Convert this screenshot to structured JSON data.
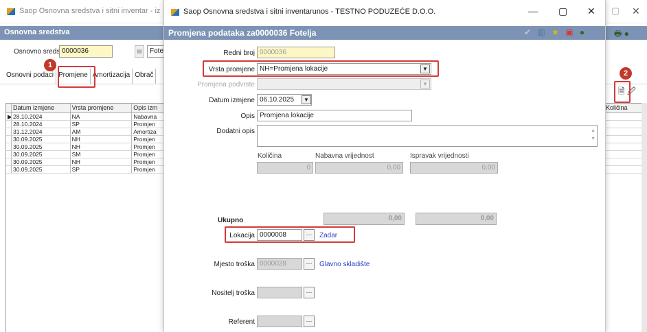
{
  "background": {
    "title": "Saop Osnovna sredstva i sitni inventar - iz",
    "subbar_title": "Osnovna sredstva",
    "osnovno_sredstvo_label": "Osnovno sredstvo",
    "osnovno_sredstvo_value": "0000036",
    "osnovno_sredstvo_name": "Fote",
    "tabs": [
      "Osnovni podaci",
      "Promjene",
      "Amortizacija",
      "Obrač"
    ],
    "grid_headers": [
      "Datum izmjene",
      "Vrsta promjene",
      "Opis izm"
    ],
    "grid_rows": [
      [
        "28.10.2024",
        "NA",
        "Nabavna"
      ],
      [
        "28.10.2024",
        "SP",
        "Promjen"
      ],
      [
        "31.12.2024",
        "AM",
        "Amortiza"
      ],
      [
        "30.09.2025",
        "NH",
        "Promjen"
      ],
      [
        "30.09.2025",
        "NH",
        "Promjen"
      ],
      [
        "30.09.2025",
        "SM",
        "Promjen"
      ],
      [
        "30.09.2025",
        "NH",
        "Promjen"
      ],
      [
        "30.09.2025",
        "SP",
        "Promjen"
      ]
    ],
    "right_header": "Količina",
    "badges": [
      "1",
      "2"
    ]
  },
  "dialog": {
    "title": "Saop Osnovna sredstva i sitni inventarunos - TESTNO PODUZEĆE D.O.O.",
    "subbar_title": "Promjena podataka za0000036 Fotelja",
    "redni_broj_label": "Redni broj",
    "redni_broj_value": "0000036",
    "vrsta_promjene_label": "Vrsta promjene",
    "vrsta_promjene_value": "NH=Promjena lokacije",
    "promjena_podvrste_label": "Promjena podvrste",
    "datum_izmjene_label": "Datum izmjene",
    "datum_izmjene_value": "06.10.2025",
    "opis_label": "Opis",
    "opis_value": "Promjena lokacije",
    "dodatni_opis_label": "Dodatni opis",
    "kolicina_label": "Količina",
    "nabavna_label": "Nabavna vrijednost",
    "ispravak_label": "Ispravak vrijednosti",
    "kolicina_value": "0",
    "nabavna_value": "0,00",
    "ispravak_value": "0,00",
    "ukupno_label": "Ukupno",
    "ukupno_nabavna": "0,00",
    "ukupno_ispravak": "0,00",
    "lokacija_label": "Lokacija",
    "lokacija_value": "0000008",
    "lokacija_name": "Zadar",
    "mjesto_troska_label": "Mjesto troška",
    "mjesto_troska_value": "0000028",
    "mjesto_troska_name": "Glavno skladište",
    "nositelj_troska_label": "Nositelj troška",
    "referent_label": "Referent"
  },
  "colors": {
    "titlebar_blue": "#7d93b6",
    "highlight_red": "#d23a3a",
    "link_blue": "#2a3ec8",
    "input_yellow": "#fdf7c4"
  }
}
